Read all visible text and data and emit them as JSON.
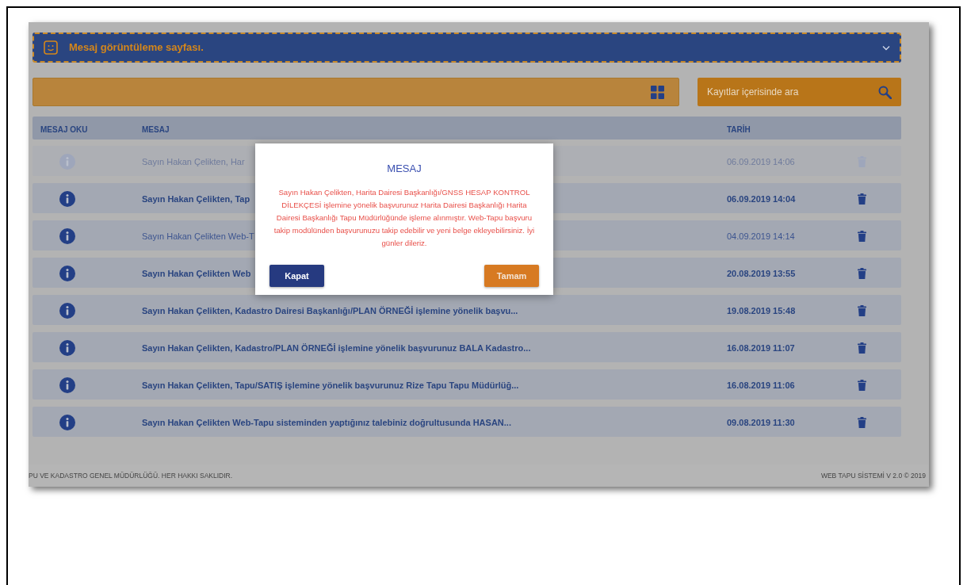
{
  "header": {
    "title": "Mesaj görüntüleme sayfası."
  },
  "search": {
    "placeholder": "Kayıtlar içerisinde ara"
  },
  "table": {
    "columns": [
      "MESAJ OKU",
      "MESAJ",
      "TARİH"
    ],
    "rows": [
      {
        "message": "Sayın Hakan Çelikten, Har",
        "date": "06.09.2019 14:06",
        "read": false,
        "dimmed": true
      },
      {
        "message": "Sayın Hakan Çelikten, Tap",
        "date": "06.09.2019 14:04",
        "read": false,
        "dimmed": false
      },
      {
        "message": "Sayın Hakan Çelikten Web-T",
        "date": "04.09.2019 14:14",
        "read": true,
        "dimmed": false
      },
      {
        "message": "Sayın Hakan Çelikten Web",
        "date": "20.08.2019 13:55",
        "read": false,
        "dimmed": false
      },
      {
        "message": "Sayın Hakan Çelikten, Kadastro Dairesi Başkanlığı/PLAN ÖRNEĞİ işlemine yönelik başvu...",
        "date": "19.08.2019 15:48",
        "read": false,
        "dimmed": false
      },
      {
        "message": "Sayın Hakan Çelikten, Kadastro/PLAN ÖRNEĞİ işlemine yönelik başvurunuz BALA Kadastro...",
        "date": "16.08.2019 11:07",
        "read": false,
        "dimmed": false
      },
      {
        "message": "Sayın Hakan Çelikten, Tapu/SATIŞ işlemine yönelik başvurunuz Rize Tapu Tapu Müdürlüğ...",
        "date": "16.08.2019 11:06",
        "read": false,
        "dimmed": false
      },
      {
        "message": "Sayın Hakan Çelikten Web-Tapu sisteminden yaptığınız talebiniz doğrultusunda HASAN...",
        "date": "09.08.2019 11:30",
        "read": false,
        "dimmed": false
      }
    ]
  },
  "modal": {
    "title": "MESAJ",
    "body": "Sayın Hakan Çelikten, Harita Dairesi Başkanlığı/GNSS HESAP KONTROL DİLEKÇESİ işlemine yönelik başvurunuz Harita Dairesi Başkanlığı Harita Dairesi Başkanlığı Tapu Müdürlüğünde işleme alınmıştır. Web-Tapu başvuru takip modülünden başvurunuzu takip edebilir ve yeni belge ekleyebilirsiniz. İyi günler dileriz.",
    "buttons": [
      {
        "label": "Kapat",
        "kind": "secondary"
      },
      {
        "label": "Tamam",
        "kind": "primary"
      }
    ]
  },
  "footer": {
    "left": "PU VE KADASTRO GENEL MÜDÜRLÜĞÜ. HER HAKKI SAKLIDIR.",
    "right": "WEB TAPU SİSTEMİ V 2.0 © 2019"
  }
}
